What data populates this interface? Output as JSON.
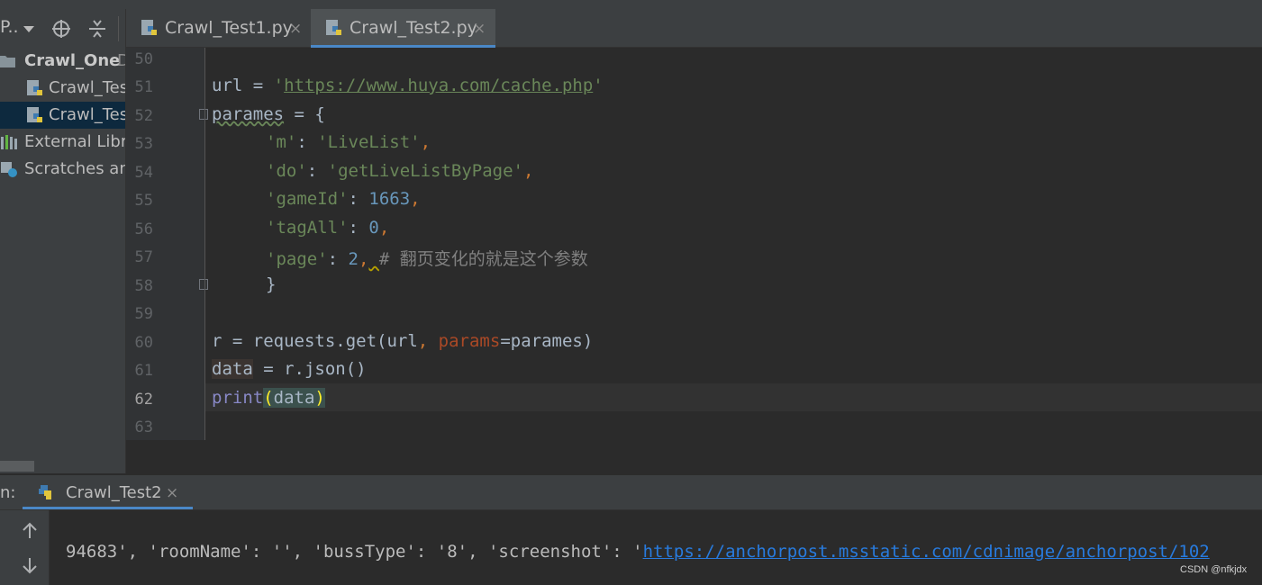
{
  "sidebar": {
    "title": "P..",
    "tree": [
      {
        "label": "Crawl_One",
        "suffix": "D",
        "icon": "folder-icon"
      },
      {
        "label": "Crawl_Tes",
        "icon": "python-file-icon"
      },
      {
        "label": "Crawl_Tes",
        "icon": "python-file-icon"
      },
      {
        "label": "External Libra",
        "icon": "library-icon"
      },
      {
        "label": "Scratches and",
        "icon": "scratches-icon"
      }
    ]
  },
  "tabs": [
    {
      "label": "Crawl_Test1.py",
      "close": "×",
      "active": false
    },
    {
      "label": "Crawl_Test2.py",
      "close": "×",
      "active": true
    }
  ],
  "editor": {
    "line_numbers": [
      "50",
      "51",
      "52",
      "53",
      "54",
      "55",
      "56",
      "57",
      "58",
      "59",
      "60",
      "61",
      "62",
      "63"
    ],
    "current_line": "62",
    "code": {
      "l51_var": "url",
      "l51_eq": " = ",
      "l51_q1": "'",
      "l51_url": "https://www.huya.com/cache.php",
      "l51_q2": "'",
      "l52_var": "parames",
      "l52_rest": " = {",
      "l53_key": "'m'",
      "l53_colon": ": ",
      "l53_val": "'LiveList'",
      "l53_comma": ",",
      "l54_key": "'do'",
      "l54_colon": ": ",
      "l54_val": "'getLiveListByPage'",
      "l54_comma": ",",
      "l55_key": "'gameId'",
      "l55_colon": ": ",
      "l55_val": "1663",
      "l55_comma": ",",
      "l56_key": "'tagAll'",
      "l56_colon": ": ",
      "l56_val": "0",
      "l56_comma": ",",
      "l57_key": "'page'",
      "l57_colon": ": ",
      "l57_val": "2",
      "l57_comma": ",",
      "l57_space": " ",
      "l57_comment": "# 翻页变化的就是这个参数",
      "l58_brace": "}",
      "l60_a": "r = requests.get(url",
      "l60_comma": ", ",
      "l60_param": "params",
      "l60_b": "=parames)",
      "l61_var": "data",
      "l61_rest": " = r.json()",
      "l62_func": "print",
      "l62_open": "(",
      "l62_arg": "data",
      "l62_close": ")"
    }
  },
  "run": {
    "label": "n:",
    "tab_label": "Crawl_Test2",
    "tab_close": "×",
    "console_text": "94683', 'roomName': '', 'bussType': '8', 'screenshot': '",
    "console_link": "https://anchorpost.msstatic.com/cdnimage/anchorpost/102"
  },
  "watermark": "CSDN @nfkjdx",
  "colors": {
    "accent": "#4a88c7",
    "selection": "#0d293e",
    "background": "#2b2b2b"
  }
}
